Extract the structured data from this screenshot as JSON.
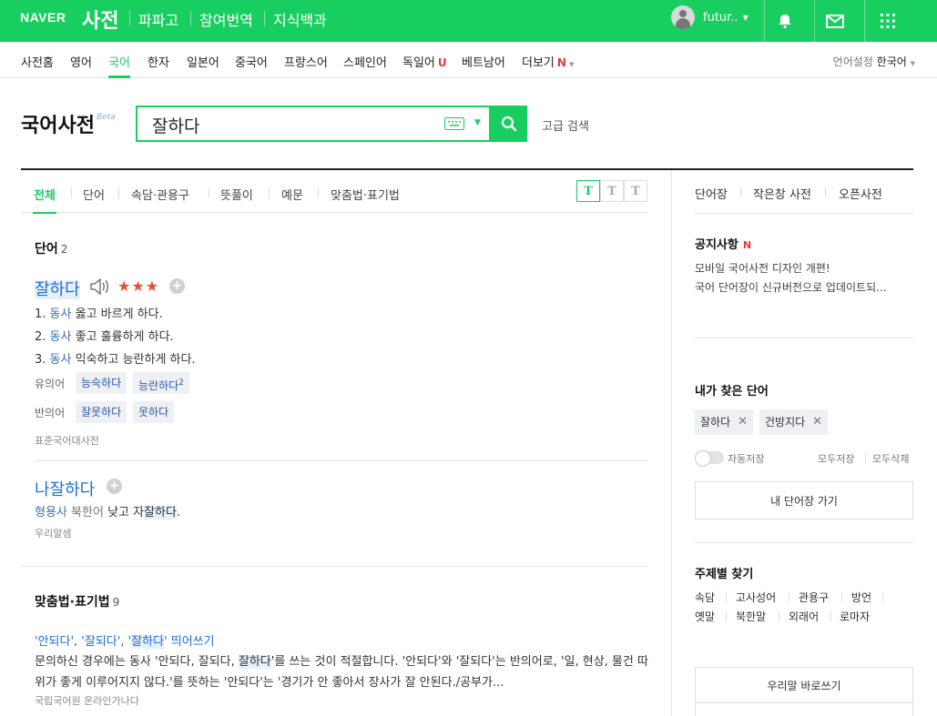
{
  "topbar": {
    "logo": "NAVER",
    "service": "사전",
    "links": [
      "파파고",
      "참여번역",
      "지식백과"
    ],
    "user_name": "futur..",
    "icons": [
      "bell-icon",
      "mail-icon",
      "apps-grid-icon"
    ]
  },
  "nav": {
    "items": [
      "사전홈",
      "영어",
      "국어",
      "한자",
      "일본어",
      "중국어",
      "프랑스어",
      "스페인어",
      "독일어",
      "베트남어",
      "더보기"
    ],
    "active": "국어",
    "badge_u": "U",
    "badge_n": "N",
    "lang_label": "언어설정",
    "lang_value": "한국어"
  },
  "search": {
    "brand": "국어사전",
    "beta": "Beta",
    "query": "잘하다",
    "advanced": "고급 검색"
  },
  "tabs": {
    "items": [
      "전체",
      "단어",
      "속담·관용구",
      "뜻풀이",
      "예문",
      "맞춤법·표기법"
    ],
    "active": "전체",
    "sizes": [
      "T",
      "T",
      "T"
    ]
  },
  "words": {
    "title": "단어",
    "count": "2",
    "entry1": {
      "word": "잘하다",
      "stars": "★★★",
      "defs": [
        {
          "num": "1.",
          "pos": "동사",
          "text": "옳고 바르게 하다."
        },
        {
          "num": "2.",
          "pos": "동사",
          "text": "좋고 훌륭하게 하다."
        },
        {
          "num": "3.",
          "pos": "동사",
          "text": "익숙하고 능란하게 하다."
        }
      ],
      "synonym_label": "유의어",
      "synonyms": [
        "능숙하다",
        "능란하다"
      ],
      "synonym_sup": "2",
      "antonym_label": "반의어",
      "antonyms": [
        "잘못하다",
        "못하다"
      ],
      "source": "표준국어대사전"
    },
    "entry2": {
      "word": "나잘하다",
      "pos": "형용사",
      "region": "북한어",
      "def_pre": "낮고 자",
      "def_hl": "잘하다",
      "def_post": ".",
      "source": "우리말샘"
    }
  },
  "spelling": {
    "title": "맞춤법·표기법",
    "count": "9",
    "item_title_pre": "'안되다', '잘되다', '",
    "item_title_hl": "잘하다",
    "item_title_post": "' 띄어쓰기",
    "body_pre": "문의하신 경우에는 동사 '안되다, 잘되다, ",
    "body_hl": "잘하다",
    "body_post": "'를 쓰는 것이 적절합니다. '안되다'와 '잘되다'는 반의어로, '일, 현상, 물건 따위가 좋게 이루어지지 않다.'를 뜻하는 '안되다'는 '경기가 안 좋아서 장사가 잘 안된다./공부가...",
    "source": "국립국어원 온라인가나다"
  },
  "sidebar": {
    "tabs": [
      "단어장",
      "작은창 사전",
      "오픈사전"
    ],
    "notice_title": "공지사항",
    "notice_badge": "N",
    "notices": [
      "모바일 국어사전 디자인 개편!",
      "국어 단어장이 신규버전으로 업데이트되..."
    ],
    "recent_title": "내가 찾은 단어",
    "recent": [
      "잘하다",
      "건방지다"
    ],
    "autosave": "자동저장",
    "save_all": "모두저장",
    "delete_all": "모두삭제",
    "wordbook_btn": "내 단어장 가기",
    "topic_title": "주제별 찾기",
    "topics_row1": [
      "속담",
      "고사성어",
      "관용구",
      "방언"
    ],
    "topics_row2": [
      "옛말",
      "북한말",
      "외래어",
      "로마자"
    ],
    "correct_btn": "우리말 바로쓰기"
  }
}
